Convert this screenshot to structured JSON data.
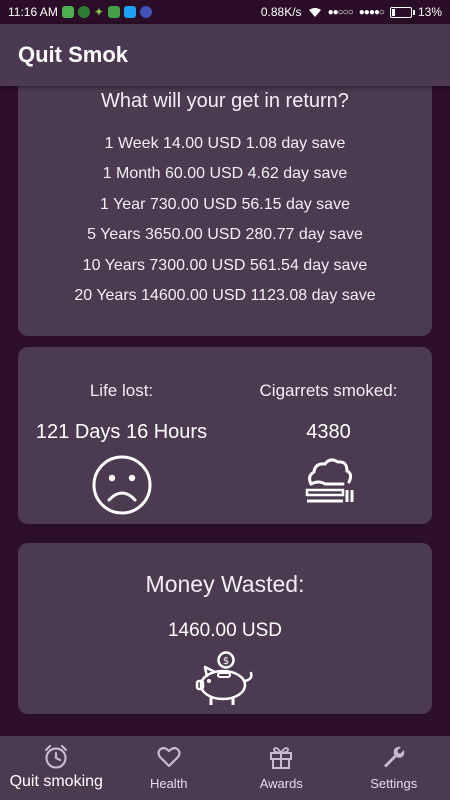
{
  "status_bar": {
    "time": "11:16 AM",
    "speed": "0.88K/s",
    "battery": "13%",
    "app_icon_colors": [
      "#4caf50",
      "#2e7d32",
      "#8bc34a",
      "#43a047",
      "#1da1f2",
      "#3f51b5"
    ]
  },
  "app_bar": {
    "title": "Quit Smok"
  },
  "returns": {
    "title": "What will your get in return?",
    "rows": [
      "1 Week 14.00 USD 1.08 day save",
      "1 Month 60.00 USD 4.62 day save",
      "1 Year 730.00 USD 56.15 day save",
      "5 Years 3650.00 USD 280.77 day save",
      "10 Years 7300.00 USD 561.54 day save",
      "20 Years 14600.00 USD 1123.08 day save"
    ]
  },
  "life": {
    "label": "Life lost:",
    "value": "121 Days 16 Hours",
    "icon": "sad-face-icon"
  },
  "cigarettes": {
    "label": "Cigarrets smoked:",
    "value": "4380",
    "icon": "cigarette-smoke-icon"
  },
  "money": {
    "label": "Money Wasted:",
    "value": "1460.00 USD",
    "icon": "piggy-bank-icon"
  },
  "nav": {
    "items": [
      {
        "label": "Quit smoking",
        "icon": "alarm-clock-icon",
        "active": true
      },
      {
        "label": "Health",
        "icon": "heart-icon",
        "active": false
      },
      {
        "label": "Awards",
        "icon": "gift-icon",
        "active": false
      },
      {
        "label": "Settings",
        "icon": "wrench-icon",
        "active": false
      }
    ]
  },
  "colors": {
    "background": "#2c0f28",
    "card": "#4b3a50",
    "app_bar": "#4a3950",
    "text": "#ffffff"
  }
}
